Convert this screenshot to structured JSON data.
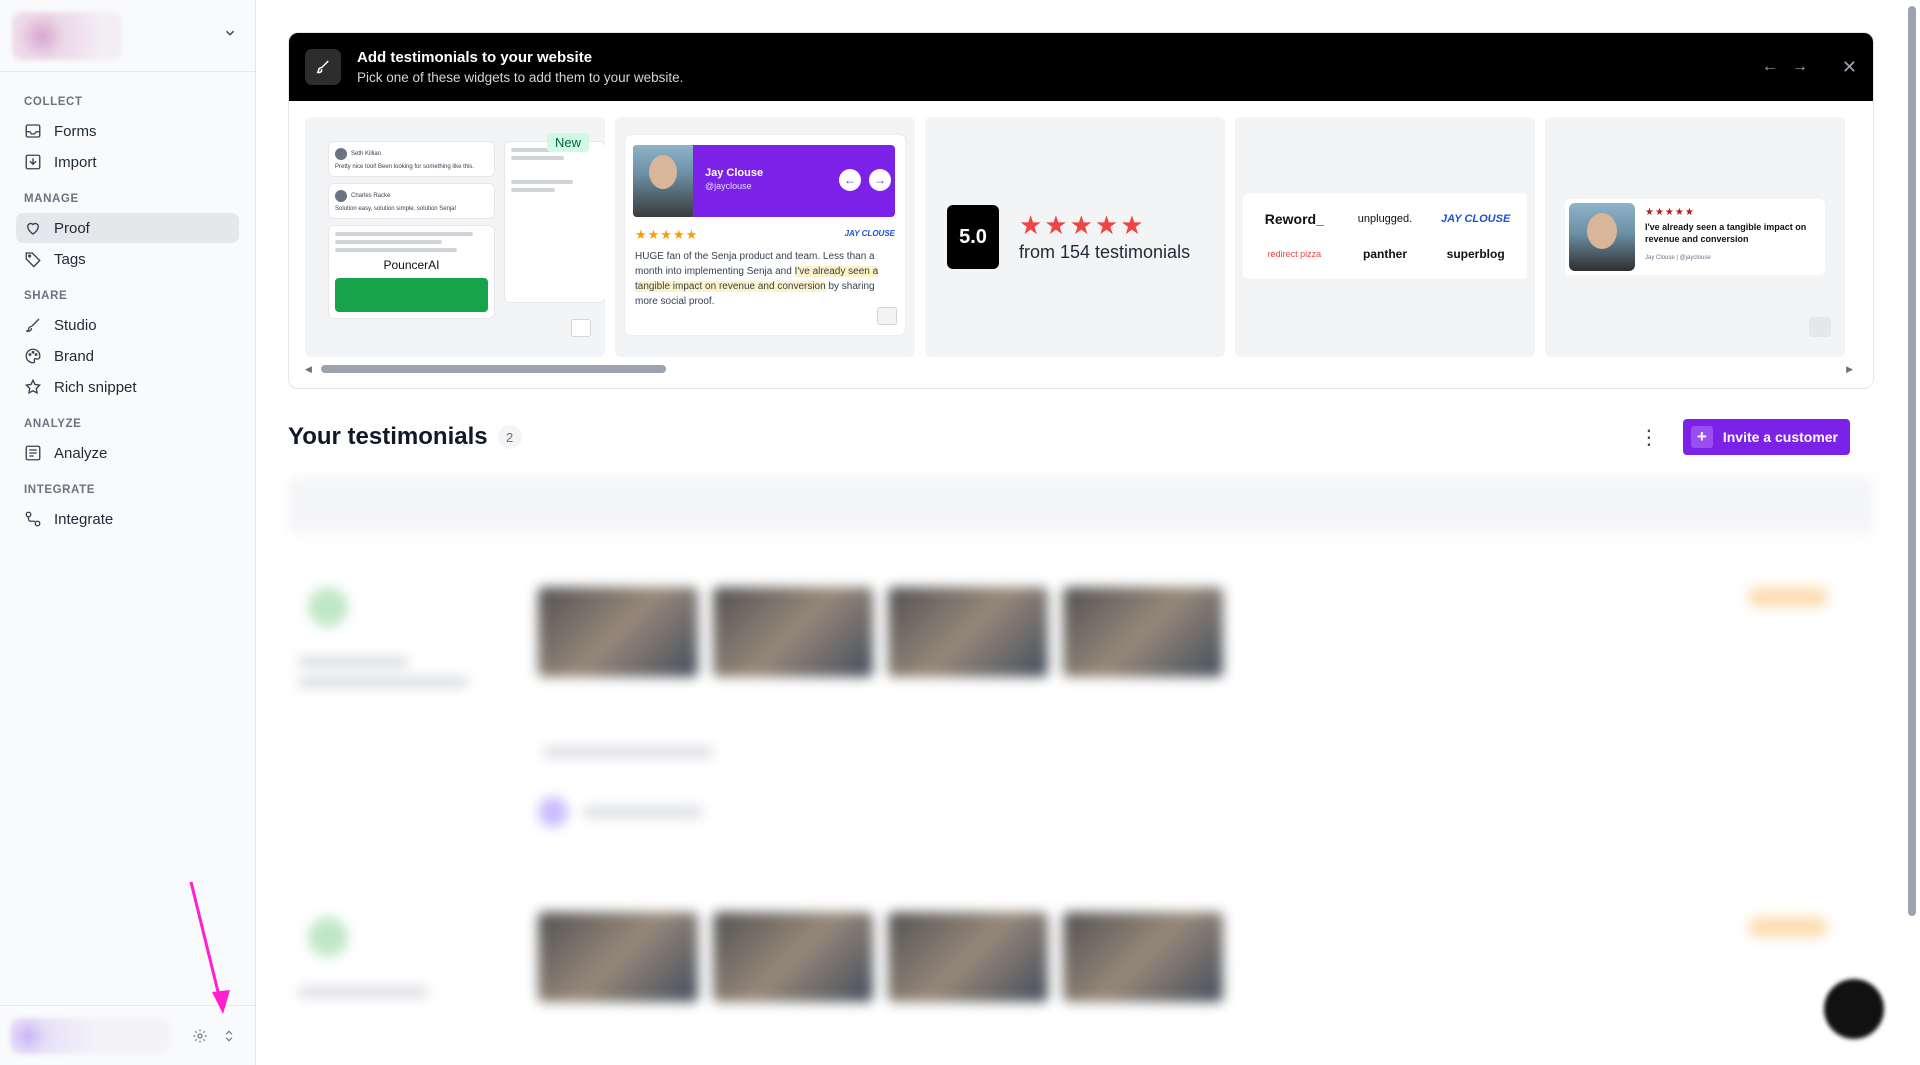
{
  "sidebar": {
    "sections": [
      {
        "label": "COLLECT",
        "items": [
          {
            "label": "Forms",
            "icon": "inbox-icon"
          },
          {
            "label": "Import",
            "icon": "import-icon"
          }
        ]
      },
      {
        "label": "MANAGE",
        "items": [
          {
            "label": "Proof",
            "icon": "heart-icon"
          },
          {
            "label": "Tags",
            "icon": "tag-icon"
          }
        ]
      },
      {
        "label": "SHARE",
        "items": [
          {
            "label": "Studio",
            "icon": "brush-icon"
          },
          {
            "label": "Brand",
            "icon": "palette-icon"
          },
          {
            "label": "Rich snippet",
            "icon": "star-icon"
          }
        ]
      },
      {
        "label": "ANALYZE",
        "items": [
          {
            "label": "Analyze",
            "icon": "analyze-icon"
          }
        ]
      },
      {
        "label": "INTEGRATE",
        "items": [
          {
            "label": "Integrate",
            "icon": "integrate-icon"
          }
        ]
      }
    ],
    "active_item": "Proof"
  },
  "widgets": {
    "title": "Add testimonials to your website",
    "subtitle": "Pick one of these widgets to add them to your website.",
    "badge_new": "New",
    "wall": {
      "name1": "Seth Killian",
      "text1": "Pretty nice tool! Been looking for something like this.",
      "name2": "Charles Racke",
      "text2": "Solution easy, solution simple, solution Senja!",
      "logo": "PouncerAI"
    },
    "carousel": {
      "name": "Jay Clouse",
      "handle": "@jayclouse",
      "stars": "★★★★★",
      "logo": "JAY CLOUSE",
      "text_before": "HUGE fan of the Senja product and team. Less than a month into implementing Senja and ",
      "text_highlight": "I've already seen a tangible impact on revenue and conversion",
      "text_after": " by sharing more social proof."
    },
    "rating": {
      "score": "5.0",
      "stars": "★★★★★",
      "text": "from 154 testimonials"
    },
    "logos": [
      "Reword_",
      "unplugged.",
      "JAY CLOUSE",
      "redirect pizza",
      "panther",
      "superblog"
    ],
    "single": {
      "stars": "★★★★★",
      "text": "I've already seen a tangible impact on revenue and conversion",
      "by": "Jay Clouse | @jayclouse"
    }
  },
  "testimonials": {
    "title": "Your testimonials",
    "count": "2",
    "invite_label": "Invite a customer"
  },
  "colors": {
    "accent": "#7c22e8",
    "annotation_arrow": "#ff1fd1",
    "stars_red": "#ef4444"
  }
}
